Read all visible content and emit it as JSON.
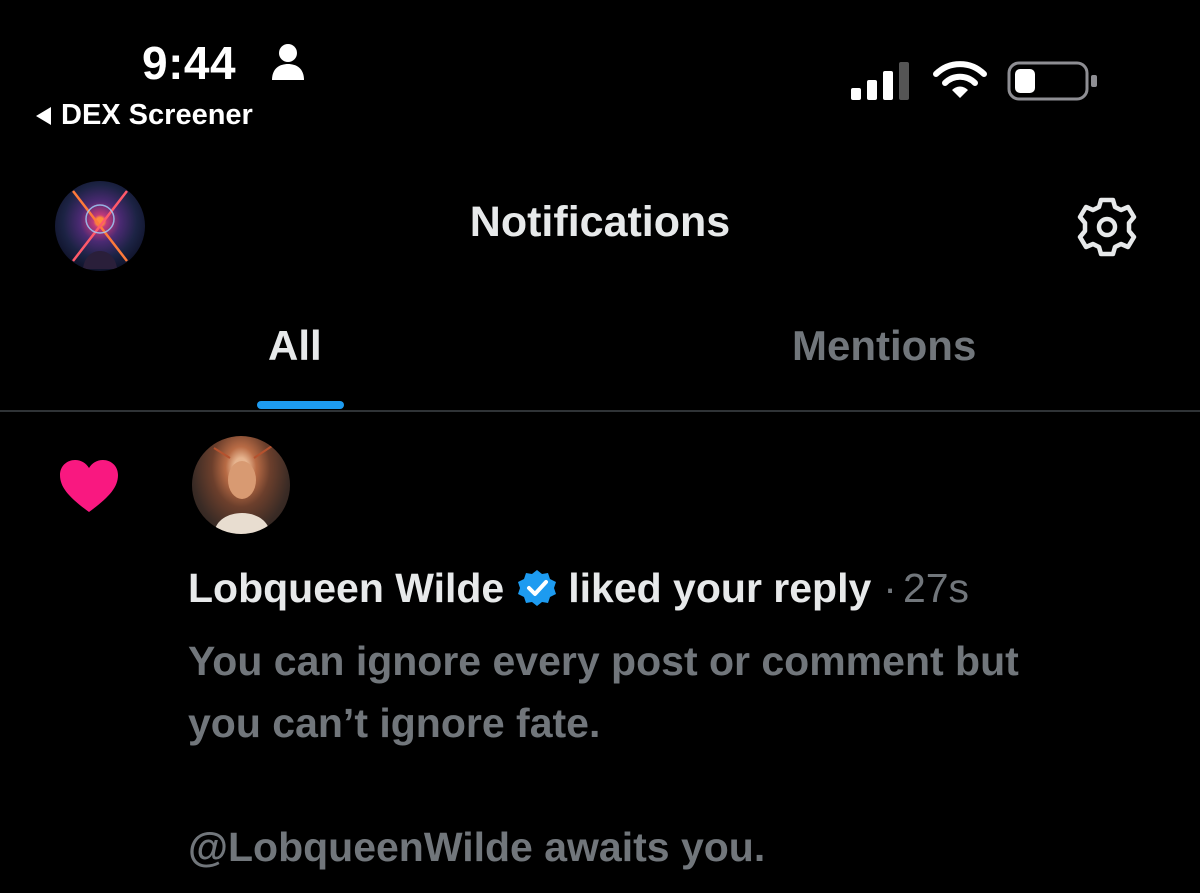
{
  "status_bar": {
    "time": "9:44",
    "back_app": "DEX Screener"
  },
  "header": {
    "title": "Notifications"
  },
  "tabs": [
    {
      "label": "All",
      "active": true
    },
    {
      "label": "Mentions",
      "active": false
    }
  ],
  "notification": {
    "type": "like",
    "user_name": "Lobqueen Wilde",
    "verified": true,
    "action": "liked your reply",
    "separator": "·",
    "timestamp": "27s",
    "post_lines": [
      "You can ignore every post or comment but",
      "you can’t ignore fate.",
      "@LobqueenWilde awaits you."
    ]
  },
  "colors": {
    "background": "#000000",
    "primary_text": "#e7e9ea",
    "secondary_text": "#71767b",
    "accent": "#1d9bf0",
    "like": "#f91880"
  }
}
